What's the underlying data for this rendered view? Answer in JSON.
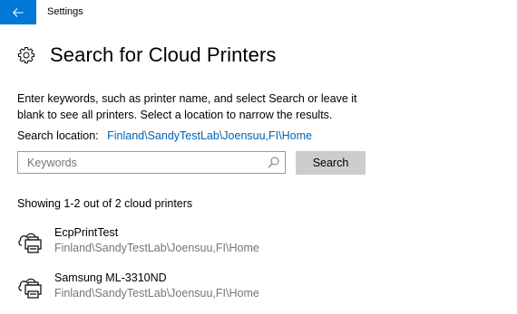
{
  "window": {
    "title": "Settings"
  },
  "page": {
    "title": "Search for Cloud Printers",
    "description": "Enter keywords, such as printer name, and select Search or leave it blank to see all printers. Select a location to narrow the results.",
    "location_label": "Search location:",
    "location_value": "Finland\\SandyTestLab\\Joensuu,FI\\Home"
  },
  "search": {
    "placeholder": "Keywords",
    "value": "",
    "button_label": "Search"
  },
  "results": {
    "summary": "Showing 1-2 out of 2 cloud printers",
    "printers": [
      {
        "name": "EcpPrintTest",
        "location": "Finland\\SandyTestLab\\Joensuu,FI\\Home",
        "icon": "cloud-printer-icon"
      },
      {
        "name": "Samsung ML-3310ND",
        "location": "Finland\\SandyTestLab\\Joensuu,FI\\Home",
        "icon": "cloud-printer-icon"
      }
    ]
  },
  "colors": {
    "accent": "#0078d7",
    "link": "#0063b1",
    "secondary_text": "#767676",
    "button_bg": "#cccccc"
  },
  "icons": {
    "back": "back-arrow-icon",
    "settings": "gear-icon",
    "search": "search-icon"
  }
}
